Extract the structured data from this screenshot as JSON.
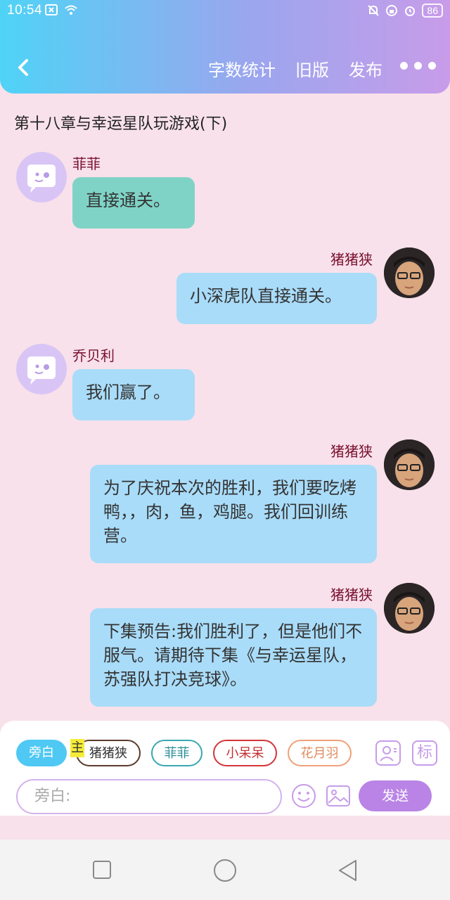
{
  "status_bar": {
    "time": "10:54",
    "battery": "86"
  },
  "header": {
    "menu": [
      "字数统计",
      "旧版",
      "发布"
    ]
  },
  "chapter_title": "第十八章与幸运星队玩游戏(下)",
  "messages": [
    {
      "sender": "菲菲",
      "text": "直接通关。",
      "side": "left",
      "color": "#7fd3c6"
    },
    {
      "sender": "猪猪狭",
      "text": "小深虎队直接通关。",
      "side": "right",
      "color": "#a9dcf9"
    },
    {
      "sender": "乔贝利",
      "text": "我们赢了。",
      "side": "left",
      "color": "#a9dcf9"
    },
    {
      "sender": "猪猪狭",
      "text": "为了庆祝本次的胜利，我们要吃烤鸭，，肉，鱼，鸡腿。我们回训练营。",
      "side": "right",
      "color": "#a9dcf9"
    },
    {
      "sender": "猪猪狭",
      "text": "下集预告:我们胜利了，但是他们不服气。请期待下集《与幸运星队，苏强队打决竞球》。",
      "side": "right",
      "color": "#a9dcf9"
    }
  ],
  "roles": {
    "narrator": "旁白",
    "main_badge": "主",
    "chips": [
      "猪猪狭",
      "菲菲",
      "小呆呆",
      "花月羽"
    ]
  },
  "tools": {
    "tag_label": "标"
  },
  "input": {
    "placeholder": "旁白:"
  },
  "send_label": "发送"
}
